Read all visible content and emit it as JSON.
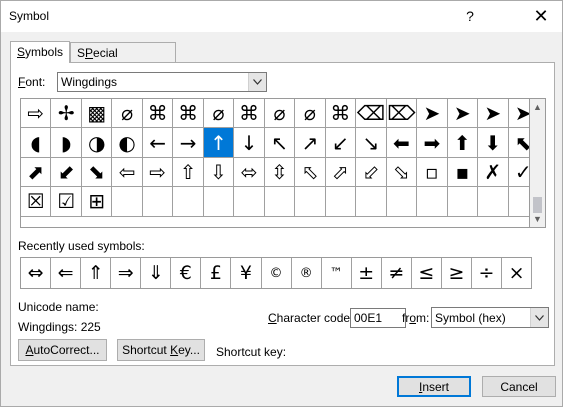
{
  "window": {
    "title": "Symbol",
    "help": "?",
    "close": "✕"
  },
  "tabs": [
    {
      "label_pre": "",
      "label_key": "S",
      "label_post": "ymbols"
    },
    {
      "label_pre": "",
      "label_key": "P",
      "label_post": "Special Characters"
    }
  ],
  "font": {
    "label_key": "F",
    "label_post": "ont:",
    "value": "Wingdings"
  },
  "grid": {
    "rows": [
      [
        "⇨",
        "✢",
        "▩",
        "⌀",
        "⌘",
        "⌘",
        "⌀",
        "⌘",
        "⌀",
        "⌀",
        "⌘",
        "⌫",
        "⌦",
        "➤",
        "➤",
        "➤",
        "➤"
      ],
      [
        "◖",
        "◗",
        "◑",
        "◐",
        "←",
        "→",
        "↑",
        "↓",
        "↖",
        "↗",
        "↙",
        "↘",
        "⬅",
        "➡",
        "⬆",
        "⬇",
        "⬉"
      ],
      [
        "⬈",
        "⬋",
        "⬊",
        "⇦",
        "⇨",
        "⇧",
        "⇩",
        "⬄",
        "⇳",
        "⬁",
        "⬀",
        "⬃",
        "⬂",
        "▫",
        "▪",
        "✗",
        "✓"
      ],
      [
        "☒",
        "☑",
        "⊞",
        "",
        "",
        "",
        "",
        "",
        "",
        "",
        "",
        "",
        "",
        "",
        "",
        "",
        ""
      ]
    ],
    "selected_row": 1,
    "selected_col": 6
  },
  "recent": {
    "label": "Recently used symbols:",
    "items": [
      "⇔",
      "⇐",
      "⇑",
      "⇒",
      "⇓",
      "€",
      "£",
      "¥",
      "©",
      "®",
      "™",
      "±",
      "≠",
      "≤",
      "≥",
      "÷",
      "×"
    ]
  },
  "unicode": {
    "name_label": "Unicode name:",
    "name_value": "Wingdings: 225"
  },
  "charcode": {
    "label_key": "C",
    "label_post": "haracter code:",
    "value": "00E1"
  },
  "from": {
    "label_pre": "fr",
    "label_key": "o",
    "label_post": "m:",
    "value": "Symbol (hex)"
  },
  "buttons": {
    "autocorrect_key": "A",
    "autocorrect_post": "utoCorrect...",
    "shortcut_pre": "Shortcut ",
    "shortcut_key": "K",
    "shortcut_post": "ey...",
    "insert_key": "I",
    "insert_post": "nsert",
    "cancel": "Cancel"
  },
  "shortcut_key_label": "Shortcut key:"
}
